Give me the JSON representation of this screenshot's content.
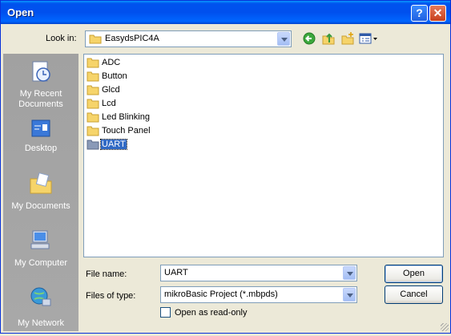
{
  "window": {
    "title": "Open"
  },
  "titlebar": {
    "help_glyph": "?",
    "close_glyph": "✕"
  },
  "look_in": {
    "label": "Look in:",
    "value": "EasydsPIC4A"
  },
  "toolbar": {
    "icons": [
      "back-icon",
      "up-folder-icon",
      "new-folder-icon",
      "views-menu-icon"
    ]
  },
  "places": [
    {
      "label": "My Recent Documents",
      "icon": "recent-documents-icon"
    },
    {
      "label": "Desktop",
      "icon": "desktop-icon"
    },
    {
      "label": "My Documents",
      "icon": "my-documents-icon"
    },
    {
      "label": "My Computer",
      "icon": "my-computer-icon"
    },
    {
      "label": "My Network",
      "icon": "my-network-icon"
    }
  ],
  "files": [
    {
      "name": "ADC",
      "selected": false
    },
    {
      "name": "Button",
      "selected": false
    },
    {
      "name": "Glcd",
      "selected": false
    },
    {
      "name": "Lcd",
      "selected": false
    },
    {
      "name": "Led Blinking",
      "selected": false
    },
    {
      "name": "Touch Panel",
      "selected": false
    },
    {
      "name": "UART",
      "selected": true
    }
  ],
  "file_name": {
    "label": "File name:",
    "value": "UART"
  },
  "file_type": {
    "label": "Files of type:",
    "value": "mikroBasic Project (*.mbpds)"
  },
  "read_only": {
    "label": "Open as read-only",
    "checked": false
  },
  "buttons": {
    "open": "Open",
    "cancel": "Cancel"
  },
  "colors": {
    "title_bar": "#0054e3",
    "places_bar": "#a5a5a5",
    "selection": "#316ac5",
    "face": "#ece9d8"
  }
}
